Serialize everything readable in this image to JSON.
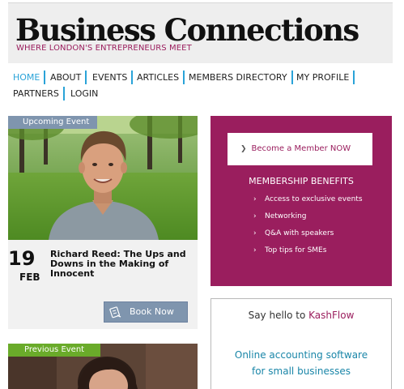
{
  "header": {
    "logo": "Business Connections",
    "tagline": "WHERE LONDON'S ENTREPRENEURS MEET"
  },
  "nav": {
    "items": [
      {
        "label": "HOME",
        "active": true
      },
      {
        "label": "ABOUT"
      },
      {
        "label": "EVENTS"
      },
      {
        "label": "ARTICLES"
      },
      {
        "label": "MEMBERS DIRECTORY"
      },
      {
        "label": "MY PROFILE"
      },
      {
        "label": "PARTNERS"
      },
      {
        "label": "LOGIN"
      }
    ]
  },
  "upcoming_event": {
    "badge": "Upcoming Event",
    "day": "19",
    "month": "FEB",
    "title": "Richard Reed: The Ups and Downs in the Making of Innocent",
    "book_label": "Book Now"
  },
  "previous_event": {
    "badge": "Previous Event"
  },
  "membership": {
    "button_label": "Become a Member NOW",
    "benefits_title": "MEMBERSHIP BENEFITS",
    "benefits": [
      "Access to exclusive events",
      "Networking",
      "Q&A with speakers",
      "Top tips for SMEs"
    ]
  },
  "ad": {
    "hello": "Say hello to ",
    "brand": "KashFlow",
    "line1": "Online accounting software",
    "line2": "for small businesses"
  },
  "colors": {
    "accent": "#9a1e5e",
    "nav_divider": "#2aa3d8",
    "upcoming_badge": "#7f95ae",
    "previous_badge": "#6aab2a"
  }
}
